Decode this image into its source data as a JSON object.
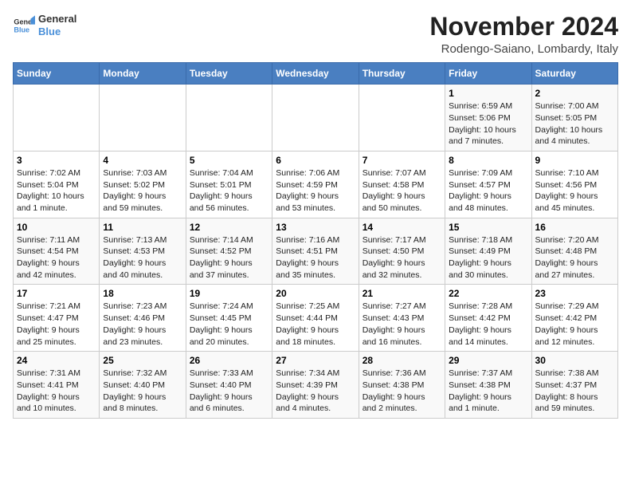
{
  "logo": {
    "line1": "General",
    "line2": "Blue"
  },
  "title": "November 2024",
  "location": "Rodengo-Saiano, Lombardy, Italy",
  "weekdays": [
    "Sunday",
    "Monday",
    "Tuesday",
    "Wednesday",
    "Thursday",
    "Friday",
    "Saturday"
  ],
  "weeks": [
    [
      {
        "day": "",
        "info": ""
      },
      {
        "day": "",
        "info": ""
      },
      {
        "day": "",
        "info": ""
      },
      {
        "day": "",
        "info": ""
      },
      {
        "day": "",
        "info": ""
      },
      {
        "day": "1",
        "info": "Sunrise: 6:59 AM\nSunset: 5:06 PM\nDaylight: 10 hours\nand 7 minutes."
      },
      {
        "day": "2",
        "info": "Sunrise: 7:00 AM\nSunset: 5:05 PM\nDaylight: 10 hours\nand 4 minutes."
      }
    ],
    [
      {
        "day": "3",
        "info": "Sunrise: 7:02 AM\nSunset: 5:04 PM\nDaylight: 10 hours\nand 1 minute."
      },
      {
        "day": "4",
        "info": "Sunrise: 7:03 AM\nSunset: 5:02 PM\nDaylight: 9 hours\nand 59 minutes."
      },
      {
        "day": "5",
        "info": "Sunrise: 7:04 AM\nSunset: 5:01 PM\nDaylight: 9 hours\nand 56 minutes."
      },
      {
        "day": "6",
        "info": "Sunrise: 7:06 AM\nSunset: 4:59 PM\nDaylight: 9 hours\nand 53 minutes."
      },
      {
        "day": "7",
        "info": "Sunrise: 7:07 AM\nSunset: 4:58 PM\nDaylight: 9 hours\nand 50 minutes."
      },
      {
        "day": "8",
        "info": "Sunrise: 7:09 AM\nSunset: 4:57 PM\nDaylight: 9 hours\nand 48 minutes."
      },
      {
        "day": "9",
        "info": "Sunrise: 7:10 AM\nSunset: 4:56 PM\nDaylight: 9 hours\nand 45 minutes."
      }
    ],
    [
      {
        "day": "10",
        "info": "Sunrise: 7:11 AM\nSunset: 4:54 PM\nDaylight: 9 hours\nand 42 minutes."
      },
      {
        "day": "11",
        "info": "Sunrise: 7:13 AM\nSunset: 4:53 PM\nDaylight: 9 hours\nand 40 minutes."
      },
      {
        "day": "12",
        "info": "Sunrise: 7:14 AM\nSunset: 4:52 PM\nDaylight: 9 hours\nand 37 minutes."
      },
      {
        "day": "13",
        "info": "Sunrise: 7:16 AM\nSunset: 4:51 PM\nDaylight: 9 hours\nand 35 minutes."
      },
      {
        "day": "14",
        "info": "Sunrise: 7:17 AM\nSunset: 4:50 PM\nDaylight: 9 hours\nand 32 minutes."
      },
      {
        "day": "15",
        "info": "Sunrise: 7:18 AM\nSunset: 4:49 PM\nDaylight: 9 hours\nand 30 minutes."
      },
      {
        "day": "16",
        "info": "Sunrise: 7:20 AM\nSunset: 4:48 PM\nDaylight: 9 hours\nand 27 minutes."
      }
    ],
    [
      {
        "day": "17",
        "info": "Sunrise: 7:21 AM\nSunset: 4:47 PM\nDaylight: 9 hours\nand 25 minutes."
      },
      {
        "day": "18",
        "info": "Sunrise: 7:23 AM\nSunset: 4:46 PM\nDaylight: 9 hours\nand 23 minutes."
      },
      {
        "day": "19",
        "info": "Sunrise: 7:24 AM\nSunset: 4:45 PM\nDaylight: 9 hours\nand 20 minutes."
      },
      {
        "day": "20",
        "info": "Sunrise: 7:25 AM\nSunset: 4:44 PM\nDaylight: 9 hours\nand 18 minutes."
      },
      {
        "day": "21",
        "info": "Sunrise: 7:27 AM\nSunset: 4:43 PM\nDaylight: 9 hours\nand 16 minutes."
      },
      {
        "day": "22",
        "info": "Sunrise: 7:28 AM\nSunset: 4:42 PM\nDaylight: 9 hours\nand 14 minutes."
      },
      {
        "day": "23",
        "info": "Sunrise: 7:29 AM\nSunset: 4:42 PM\nDaylight: 9 hours\nand 12 minutes."
      }
    ],
    [
      {
        "day": "24",
        "info": "Sunrise: 7:31 AM\nSunset: 4:41 PM\nDaylight: 9 hours\nand 10 minutes."
      },
      {
        "day": "25",
        "info": "Sunrise: 7:32 AM\nSunset: 4:40 PM\nDaylight: 9 hours\nand 8 minutes."
      },
      {
        "day": "26",
        "info": "Sunrise: 7:33 AM\nSunset: 4:40 PM\nDaylight: 9 hours\nand 6 minutes."
      },
      {
        "day": "27",
        "info": "Sunrise: 7:34 AM\nSunset: 4:39 PM\nDaylight: 9 hours\nand 4 minutes."
      },
      {
        "day": "28",
        "info": "Sunrise: 7:36 AM\nSunset: 4:38 PM\nDaylight: 9 hours\nand 2 minutes."
      },
      {
        "day": "29",
        "info": "Sunrise: 7:37 AM\nSunset: 4:38 PM\nDaylight: 9 hours\nand 1 minute."
      },
      {
        "day": "30",
        "info": "Sunrise: 7:38 AM\nSunset: 4:37 PM\nDaylight: 8 hours\nand 59 minutes."
      }
    ]
  ]
}
